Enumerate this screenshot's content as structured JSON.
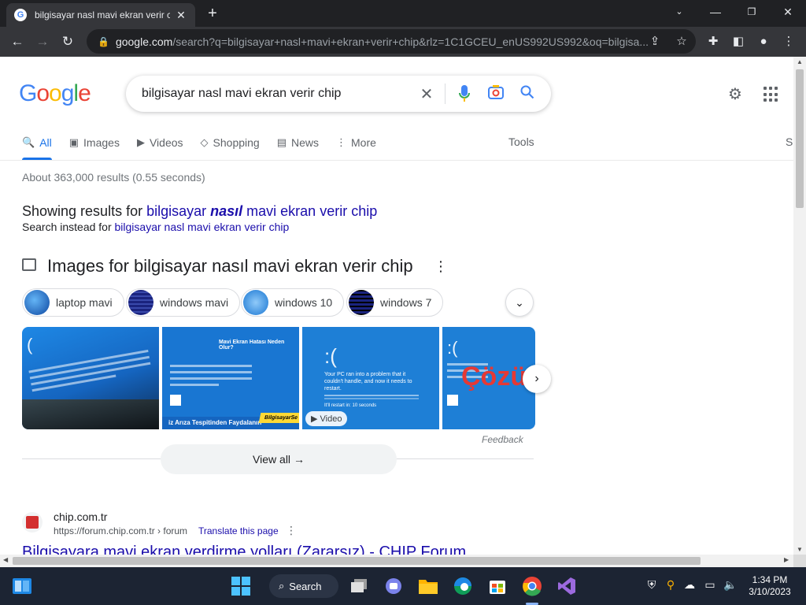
{
  "browser": {
    "tab_title": "bilgisayar nasl mavi ekran verir chip",
    "tab_close": "✕",
    "new_tab": "+",
    "url_host": "google.com",
    "url_path": "/search?q=bilgisayar+nasl+mavi+ekran+verir+chip&rlz=1C1GCEU_enUS992US992&oq=bilgisa..."
  },
  "search": {
    "logo": [
      "G",
      "o",
      "o",
      "g",
      "l",
      "e"
    ],
    "query": "bilgisayar nasl mavi ekran verir chip",
    "tabs": [
      {
        "label": "All",
        "icon": "🔍"
      },
      {
        "label": "Images",
        "icon": "▣"
      },
      {
        "label": "Videos",
        "icon": "▶"
      },
      {
        "label": "Shopping",
        "icon": "◇"
      },
      {
        "label": "News",
        "icon": "▤"
      },
      {
        "label": "More",
        "icon": "⋮"
      }
    ],
    "tools": "Tools",
    "tools_cut": "S"
  },
  "results": {
    "stats": "About 363,000 results (0.55 seconds)",
    "showing_prefix": "Showing results for ",
    "showing_pre": "bilgisayar ",
    "showing_bold": "nasıl",
    "showing_post": " mavi ekran verir chip",
    "instead_prefix": "Search instead for ",
    "instead_link": "bilgisayar nasl mavi ekran verir chip"
  },
  "images_section": {
    "heading": "Images for bilgisayar nasıl mavi ekran verir chip",
    "chips": [
      "laptop mavi",
      "windows mavi",
      "windows 10",
      "windows 7"
    ],
    "card2_title": "Mavi Ekran Hatası Neden Olur?",
    "card2_footer": "iz Arıza Tespitinden Faydalanın",
    "card2_brand": "BilgisayarSe",
    "card3_text": "Your PC ran into a problem that it couldn't handle, and now it needs to restart.",
    "card3_restart": "It'll restart in: 10 seconds",
    "card4_text": "Çözü",
    "video_badge": "Video",
    "feedback": "Feedback",
    "view_all": "View all"
  },
  "first_result": {
    "site": "chip.com.tr",
    "url": "https://forum.chip.com.tr › forum",
    "translate": "Translate this page",
    "title": "Bilgisayara mavi ekran verdirme yolları (Zararsız) - CHIP Forum"
  },
  "taskbar": {
    "search_label": "Search",
    "time": "1:34 PM",
    "date": "3/10/2023"
  },
  "colors": {
    "link": "#1a0dab",
    "accent": "#1a73e8",
    "bsod_blue": "#1565c0"
  }
}
